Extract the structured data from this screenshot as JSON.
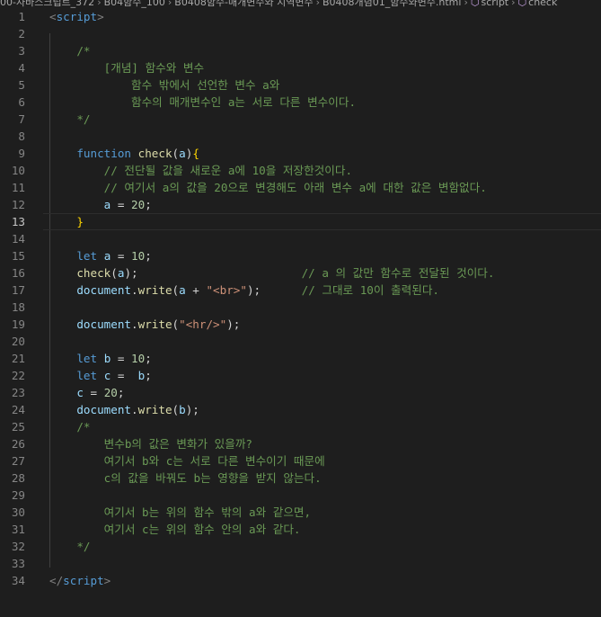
{
  "breadcrumb": {
    "items": [
      "00-자바스크립트_372",
      "B04함수_100",
      "B0408함수-매개변수와 지역변수",
      "B0408개념01_함수와변수.html",
      "script",
      "check"
    ]
  },
  "editor": {
    "active_line": 13,
    "lines": [
      {
        "n": "1",
        "tokens": [
          {
            "t": "<",
            "c": "pun"
          },
          {
            "t": "script",
            "c": "tag"
          },
          {
            "t": ">",
            "c": "pun"
          }
        ]
      },
      {
        "n": "2",
        "tokens": []
      },
      {
        "n": "3",
        "tokens": [
          {
            "t": "    /*",
            "c": "cm"
          }
        ]
      },
      {
        "n": "4",
        "tokens": [
          {
            "t": "        [개념] 함수와 변수",
            "c": "cm"
          }
        ]
      },
      {
        "n": "5",
        "tokens": [
          {
            "t": "            함수 밖에서 선언한 변수 a와",
            "c": "cm"
          }
        ]
      },
      {
        "n": "6",
        "tokens": [
          {
            "t": "            함수의 매개변수인 a는 서로 다른 변수이다.",
            "c": "cm"
          }
        ]
      },
      {
        "n": "7",
        "tokens": [
          {
            "t": "    */",
            "c": "cm"
          }
        ]
      },
      {
        "n": "8",
        "tokens": []
      },
      {
        "n": "9",
        "tokens": [
          {
            "t": "    ",
            "c": "op"
          },
          {
            "t": "function",
            "c": "kw"
          },
          {
            "t": " ",
            "c": "op"
          },
          {
            "t": "check",
            "c": "fn"
          },
          {
            "t": "(",
            "c": "op"
          },
          {
            "t": "a",
            "c": "var"
          },
          {
            "t": ")",
            "c": "op"
          },
          {
            "t": "{",
            "c": "br"
          }
        ]
      },
      {
        "n": "10",
        "tokens": [
          {
            "t": "        // 전단될 값을 새로운 a에 10을 저장한것이다.",
            "c": "cm"
          }
        ]
      },
      {
        "n": "11",
        "tokens": [
          {
            "t": "        // 여기서 a의 값을 20으로 변경해도 아래 변수 a에 대한 값은 변함없다.",
            "c": "cm"
          }
        ]
      },
      {
        "n": "12",
        "tokens": [
          {
            "t": "        ",
            "c": "op"
          },
          {
            "t": "a",
            "c": "var"
          },
          {
            "t": " = ",
            "c": "op"
          },
          {
            "t": "20",
            "c": "num"
          },
          {
            "t": ";",
            "c": "op"
          }
        ]
      },
      {
        "n": "13",
        "tokens": [
          {
            "t": "    ",
            "c": "op"
          },
          {
            "t": "}",
            "c": "br match"
          }
        ]
      },
      {
        "n": "14",
        "tokens": []
      },
      {
        "n": "15",
        "tokens": [
          {
            "t": "    ",
            "c": "op"
          },
          {
            "t": "let",
            "c": "kw"
          },
          {
            "t": " ",
            "c": "op"
          },
          {
            "t": "a",
            "c": "var"
          },
          {
            "t": " = ",
            "c": "op"
          },
          {
            "t": "10",
            "c": "num"
          },
          {
            "t": ";",
            "c": "op"
          }
        ]
      },
      {
        "n": "16",
        "tokens": [
          {
            "t": "    ",
            "c": "op"
          },
          {
            "t": "check",
            "c": "fn"
          },
          {
            "t": "(",
            "c": "op"
          },
          {
            "t": "a",
            "c": "var"
          },
          {
            "t": ");                        ",
            "c": "op"
          },
          {
            "t": "// a 의 값만 함수로 전달된 것이다.",
            "c": "cm"
          }
        ]
      },
      {
        "n": "17",
        "tokens": [
          {
            "t": "    ",
            "c": "op"
          },
          {
            "t": "document",
            "c": "var"
          },
          {
            "t": ".",
            "c": "op"
          },
          {
            "t": "write",
            "c": "fn"
          },
          {
            "t": "(",
            "c": "op"
          },
          {
            "t": "a",
            "c": "var"
          },
          {
            "t": " + ",
            "c": "op"
          },
          {
            "t": "\"<br>\"",
            "c": "str"
          },
          {
            "t": ");      ",
            "c": "op"
          },
          {
            "t": "// 그대로 10이 출력된다.",
            "c": "cm"
          }
        ]
      },
      {
        "n": "18",
        "tokens": []
      },
      {
        "n": "19",
        "tokens": [
          {
            "t": "    ",
            "c": "op"
          },
          {
            "t": "document",
            "c": "var"
          },
          {
            "t": ".",
            "c": "op"
          },
          {
            "t": "write",
            "c": "fn"
          },
          {
            "t": "(",
            "c": "op"
          },
          {
            "t": "\"<hr/>\"",
            "c": "str"
          },
          {
            "t": ");",
            "c": "op"
          }
        ]
      },
      {
        "n": "20",
        "tokens": []
      },
      {
        "n": "21",
        "tokens": [
          {
            "t": "    ",
            "c": "op"
          },
          {
            "t": "let",
            "c": "kw"
          },
          {
            "t": " ",
            "c": "op"
          },
          {
            "t": "b",
            "c": "var"
          },
          {
            "t": " = ",
            "c": "op"
          },
          {
            "t": "10",
            "c": "num"
          },
          {
            "t": ";",
            "c": "op"
          }
        ]
      },
      {
        "n": "22",
        "tokens": [
          {
            "t": "    ",
            "c": "op"
          },
          {
            "t": "let",
            "c": "kw"
          },
          {
            "t": " ",
            "c": "op"
          },
          {
            "t": "c",
            "c": "var"
          },
          {
            "t": " =  ",
            "c": "op"
          },
          {
            "t": "b",
            "c": "var"
          },
          {
            "t": ";",
            "c": "op"
          }
        ]
      },
      {
        "n": "23",
        "tokens": [
          {
            "t": "    ",
            "c": "op"
          },
          {
            "t": "c",
            "c": "var"
          },
          {
            "t": " = ",
            "c": "op"
          },
          {
            "t": "20",
            "c": "num"
          },
          {
            "t": ";",
            "c": "op"
          }
        ]
      },
      {
        "n": "24",
        "tokens": [
          {
            "t": "    ",
            "c": "op"
          },
          {
            "t": "document",
            "c": "var"
          },
          {
            "t": ".",
            "c": "op"
          },
          {
            "t": "write",
            "c": "fn"
          },
          {
            "t": "(",
            "c": "op"
          },
          {
            "t": "b",
            "c": "var"
          },
          {
            "t": ");",
            "c": "op"
          }
        ]
      },
      {
        "n": "25",
        "tokens": [
          {
            "t": "    /*",
            "c": "cm"
          }
        ]
      },
      {
        "n": "26",
        "tokens": [
          {
            "t": "        변수b의 값은 변화가 있을까?",
            "c": "cm"
          }
        ]
      },
      {
        "n": "27",
        "tokens": [
          {
            "t": "        여기서 b와 c는 서로 다른 변수이기 때문에",
            "c": "cm"
          }
        ]
      },
      {
        "n": "28",
        "tokens": [
          {
            "t": "        c의 값을 바꿔도 b는 영향을 받지 않는다.",
            "c": "cm"
          }
        ]
      },
      {
        "n": "29",
        "tokens": []
      },
      {
        "n": "30",
        "tokens": [
          {
            "t": "        여기서 b는 위의 함수 밖의 a와 같으면,",
            "c": "cm"
          }
        ]
      },
      {
        "n": "31",
        "tokens": [
          {
            "t": "        여기서 c는 위의 함수 안의 a와 같다.",
            "c": "cm"
          }
        ]
      },
      {
        "n": "32",
        "tokens": [
          {
            "t": "    */",
            "c": "cm"
          }
        ]
      },
      {
        "n": "33",
        "tokens": []
      },
      {
        "n": "34",
        "tokens": [
          {
            "t": "</",
            "c": "pun"
          },
          {
            "t": "script",
            "c": "tag"
          },
          {
            "t": ">",
            "c": "pun"
          }
        ]
      }
    ]
  }
}
